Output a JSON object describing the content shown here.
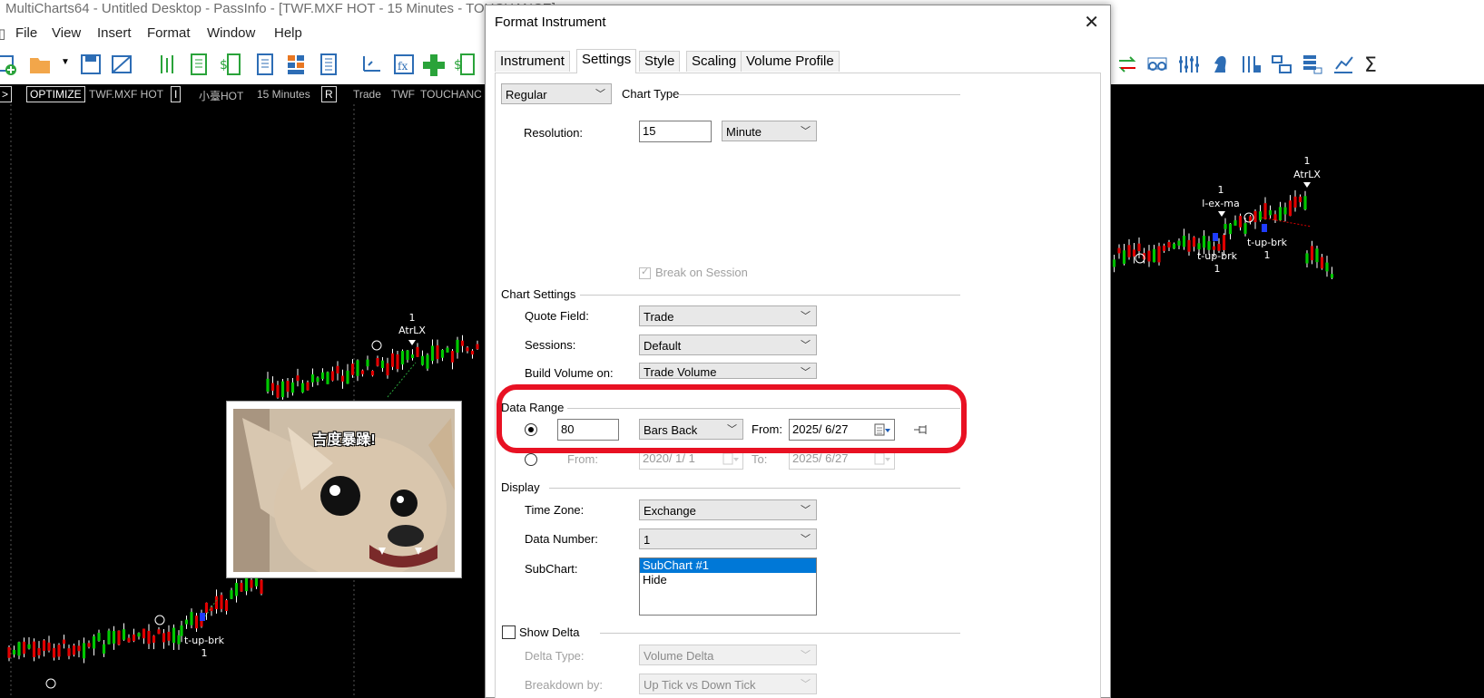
{
  "app": {
    "title": "MultiCharts64 - Untitled Desktop - PassInfo - [TWF.MXF HOT - 15 Minutes - TOUCHANCE]",
    "menu": [
      "File",
      "View",
      "Insert",
      "Format",
      "Window",
      "Help"
    ]
  },
  "instrument_bar": {
    "optimize": "OPTIMIZE",
    "symbol": "TWF.MXF HOT",
    "box1": "I",
    "name": "小臺HOT",
    "resolution": "15 Minutes",
    "box2": "R",
    "field": "Trade",
    "exchange": "TWF",
    "source": "TOUCHANC"
  },
  "chart": {
    "labels": [
      {
        "text": "1",
        "name": "trade-count-label"
      },
      {
        "text": "AtrLX",
        "name": "atrlx-label"
      },
      {
        "text": "t-up-brk",
        "name": "t-up-brk-label"
      },
      {
        "text": "1",
        "name": "trade-count-label"
      },
      {
        "text": "1",
        "name": "trade-count-label"
      },
      {
        "text": "l-ex-ma",
        "name": "l-ex-ma-label"
      },
      {
        "text": "1",
        "name": "trade-count-label"
      },
      {
        "text": "AtrLX",
        "name": "atrlx-label"
      },
      {
        "text": "t-up-brk",
        "name": "t-up-brk-label"
      },
      {
        "text": "1",
        "name": "trade-count-label"
      },
      {
        "text": "t-up-brk",
        "name": "t-up-brk-label"
      },
      {
        "text": "1",
        "name": "trade-count-label"
      }
    ],
    "meme_caption": "吉度暴躁!"
  },
  "dialog": {
    "title": "Format Instrument",
    "tabs": [
      "Instrument",
      "Settings",
      "Style",
      "Scaling",
      "Volume Profile"
    ],
    "active_tab": "Settings",
    "chart_type_value": "Regular",
    "chart_type_label": "Chart Type",
    "resolution_label": "Resolution:",
    "resolution_value": "15",
    "resolution_unit": "Minute",
    "break_on_session": "Break on Session",
    "chart_settings": {
      "group": "Chart Settings",
      "quote_field_label": "Quote Field:",
      "quote_field_value": "Trade",
      "sessions_label": "Sessions:",
      "sessions_value": "Default",
      "build_volume_label": "Build Volume on:",
      "build_volume_value": "Trade Volume"
    },
    "data_range": {
      "group": "Data Range",
      "bars_value": "80",
      "bars_mode": "Bars Back",
      "from_label": "From:",
      "from_date": "2025/  6/27",
      "range_from_label": "From:",
      "range_from_date": "2020/  1/  1",
      "range_to_label": "To:",
      "range_to_date": "2025/  6/27"
    },
    "display": {
      "group": "Display",
      "time_zone_label": "Time Zone:",
      "time_zone_value": "Exchange",
      "data_number_label": "Data Number:",
      "data_number_value": "1",
      "subchart_label": "SubChart:",
      "subchart_items": [
        "SubChart #1",
        "Hide"
      ]
    },
    "show_delta": {
      "label": "Show Delta",
      "delta_type_label": "Delta Type:",
      "delta_type_value": "Volume Delta",
      "breakdown_label": "Breakdown by:",
      "breakdown_value": "Up Tick vs Down Tick"
    }
  },
  "colors": {
    "up_candle": "#00c800",
    "down_candle": "#e00000",
    "highlight": "#e81123",
    "selection": "#0078d7"
  }
}
